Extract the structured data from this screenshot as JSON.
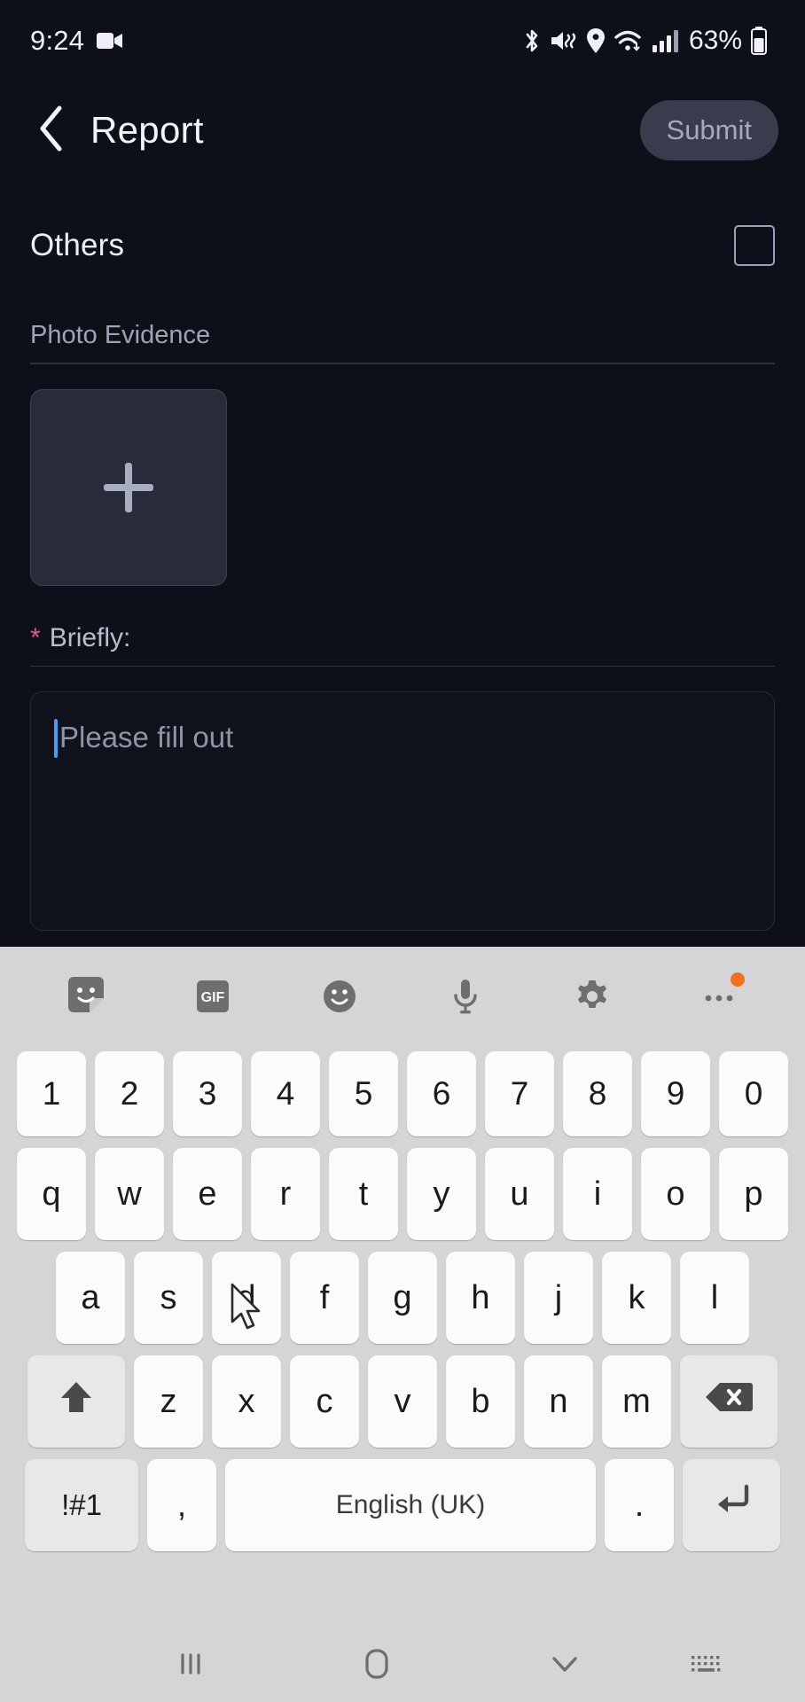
{
  "status_bar": {
    "time": "9:24",
    "battery_percent": "63%",
    "icons": [
      "video-camera-icon",
      "bluetooth-icon",
      "mute-vibrate-icon",
      "location-pin-icon",
      "wifi-icon",
      "cellular-signal-icon",
      "battery-icon"
    ]
  },
  "app_bar": {
    "back_icon": "chevron-left-icon",
    "title": "Report",
    "submit_label": "Submit",
    "submit_bg": "#3a3c4e",
    "submit_text_color": "#a6a9bb"
  },
  "form": {
    "others_label": "Others",
    "others_checked": false,
    "photo_label": "Photo Evidence",
    "photo_add_icon": "plus-icon",
    "briefly_star": "*",
    "briefly_label": "Briefly:",
    "briefly_star_color": "#e0589a",
    "briefly_placeholder": "Please fill out",
    "briefly_value": "",
    "caret_color": "#4b9cf5"
  },
  "keyboard": {
    "toolbar": [
      {
        "name": "sticker-icon",
        "label": ""
      },
      {
        "name": "gif-icon",
        "label": "GIF"
      },
      {
        "name": "emoji-icon",
        "label": ""
      },
      {
        "name": "microphone-icon",
        "label": ""
      },
      {
        "name": "gear-icon",
        "label": ""
      },
      {
        "name": "more-options-icon",
        "label": "",
        "badge": true
      }
    ],
    "row_numbers": [
      "1",
      "2",
      "3",
      "4",
      "5",
      "6",
      "7",
      "8",
      "9",
      "0"
    ],
    "row_top": [
      "q",
      "w",
      "e",
      "r",
      "t",
      "y",
      "u",
      "i",
      "o",
      "p"
    ],
    "row_home": [
      "a",
      "s",
      "d",
      "f",
      "g",
      "h",
      "j",
      "k",
      "l"
    ],
    "row_bottom": [
      "z",
      "x",
      "c",
      "v",
      "b",
      "n",
      "m"
    ],
    "shift_icon": "shift-arrow-icon",
    "backspace_icon": "backspace-icon",
    "symbols_label": "!#1",
    "comma_label": ",",
    "space_label": "English (UK)",
    "period_label": ".",
    "enter_icon": "enter-arrow-icon",
    "key_bg": "#fbfbfb",
    "mod_key_bg": "#e8e8e9",
    "keyboard_bg": "#d5d5d7"
  },
  "nav_bar": {
    "recents_icon": "recents-icon",
    "home_icon": "home-icon",
    "hide_keyboard_icon": "chevron-down-icon",
    "keyboard_switch_icon": "keyboard-icon"
  },
  "cursor": {
    "name": "mouse-pointer-icon"
  }
}
